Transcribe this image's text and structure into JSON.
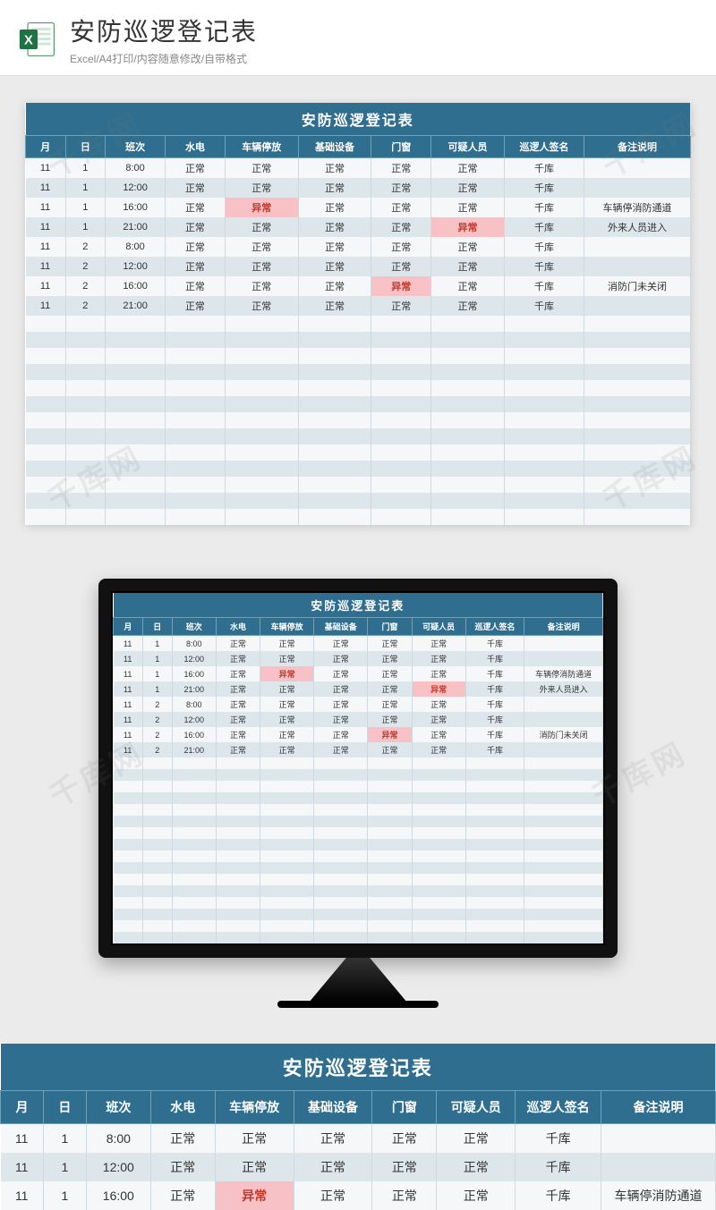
{
  "header": {
    "title": "安防巡逻登记表",
    "subtitle": "Excel/A4打印/内容随意修改/自带格式"
  },
  "watermark_text": "千库网",
  "table": {
    "title": "安防巡逻登记表",
    "columns": [
      "月",
      "日",
      "班次",
      "水电",
      "车辆停放",
      "基础设备",
      "门窗",
      "可疑人员",
      "巡逻人签名",
      "备注说明"
    ],
    "rows": [
      {
        "month": "11",
        "day": "1",
        "shift": "8:00",
        "water": "正常",
        "vehicle": "正常",
        "equipment": "正常",
        "door": "正常",
        "suspect": "正常",
        "sign": "千库",
        "note": ""
      },
      {
        "month": "11",
        "day": "1",
        "shift": "12:00",
        "water": "正常",
        "vehicle": "正常",
        "equipment": "正常",
        "door": "正常",
        "suspect": "正常",
        "sign": "千库",
        "note": ""
      },
      {
        "month": "11",
        "day": "1",
        "shift": "16:00",
        "water": "正常",
        "vehicle": "异常",
        "equipment": "正常",
        "door": "正常",
        "suspect": "正常",
        "sign": "千库",
        "note": "车辆停消防通道"
      },
      {
        "month": "11",
        "day": "1",
        "shift": "21:00",
        "water": "正常",
        "vehicle": "正常",
        "equipment": "正常",
        "door": "正常",
        "suspect": "异常",
        "sign": "千库",
        "note": "外来人员进入"
      },
      {
        "month": "11",
        "day": "2",
        "shift": "8:00",
        "water": "正常",
        "vehicle": "正常",
        "equipment": "正常",
        "door": "正常",
        "suspect": "正常",
        "sign": "千库",
        "note": ""
      },
      {
        "month": "11",
        "day": "2",
        "shift": "12:00",
        "water": "正常",
        "vehicle": "正常",
        "equipment": "正常",
        "door": "正常",
        "suspect": "正常",
        "sign": "千库",
        "note": ""
      },
      {
        "month": "11",
        "day": "2",
        "shift": "16:00",
        "water": "正常",
        "vehicle": "正常",
        "equipment": "正常",
        "door": "异常",
        "suspect": "正常",
        "sign": "千库",
        "note": "消防门未关闭"
      },
      {
        "month": "11",
        "day": "2",
        "shift": "21:00",
        "water": "正常",
        "vehicle": "正常",
        "equipment": "正常",
        "door": "正常",
        "suspect": "正常",
        "sign": "千库",
        "note": ""
      }
    ],
    "empty_rows_main": 13,
    "empty_rows_monitor": 16,
    "bottom_rows": 3
  },
  "colors": {
    "header_bg": "#2f6e8e",
    "abnormal_bg": "#f7c1c5",
    "abnormal_text": "#c0392b"
  }
}
